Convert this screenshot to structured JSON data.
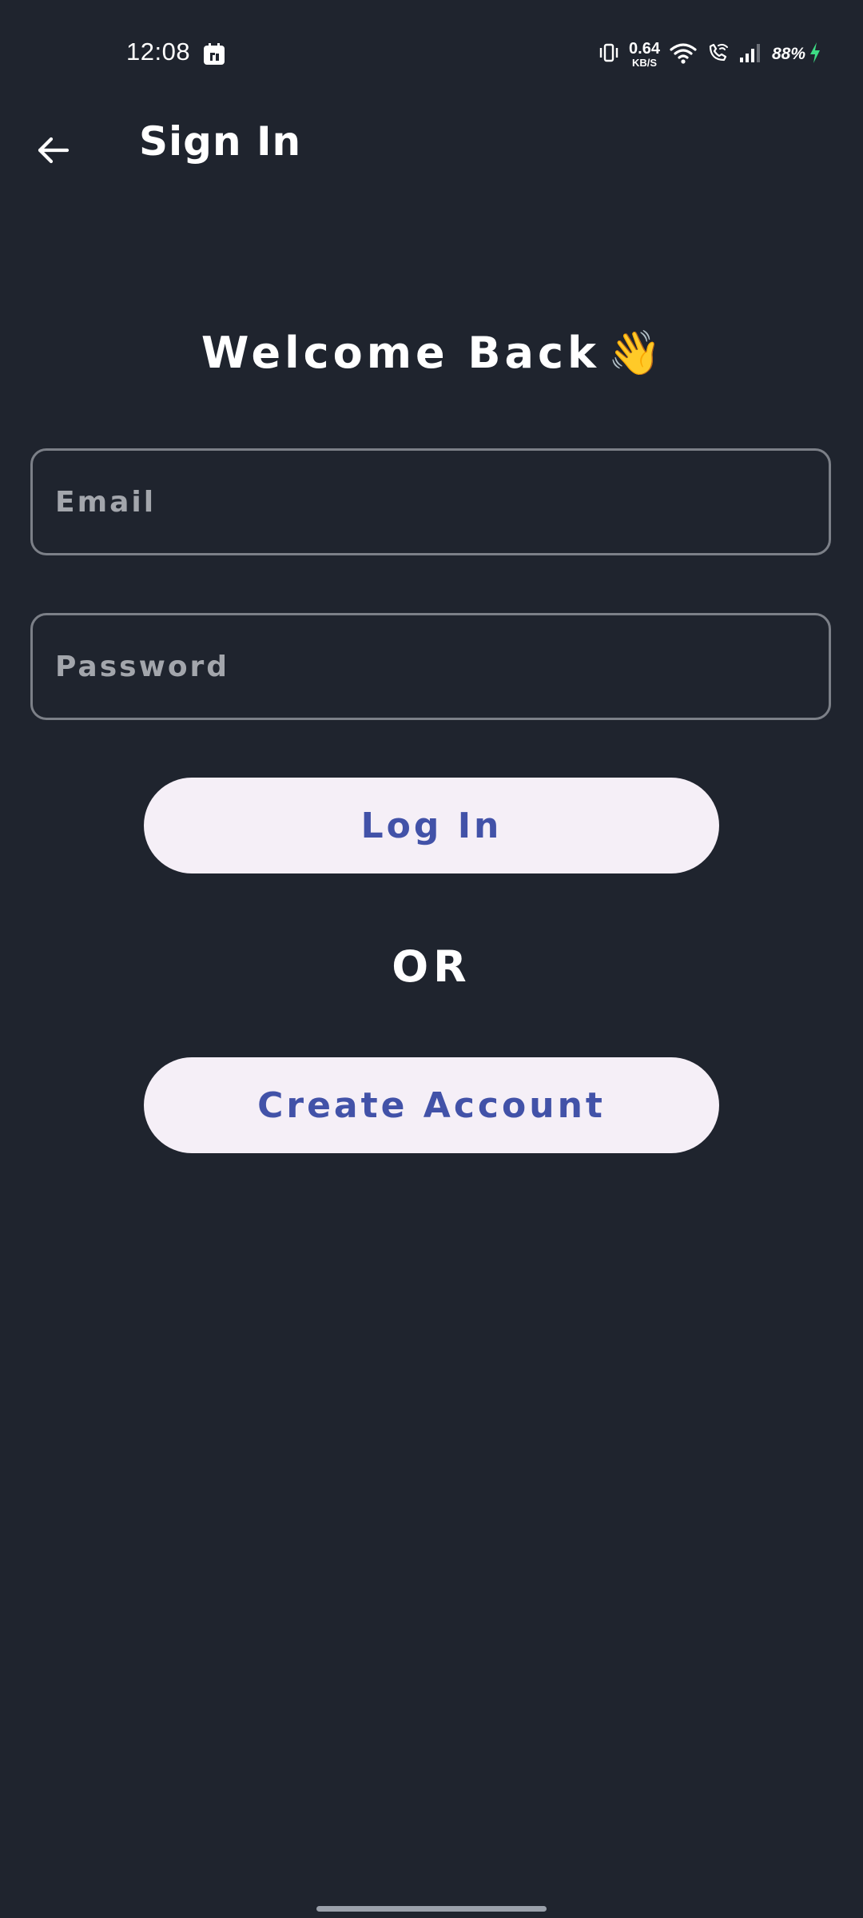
{
  "status_bar": {
    "time": "12:08",
    "net_speed_value": "0.64",
    "net_speed_unit": "KB/S",
    "battery": "88%",
    "icons": [
      "app-notification-icon",
      "vibrate-icon",
      "wifi-icon",
      "wifi-calling-icon",
      "signal-icon",
      "charging-icon"
    ]
  },
  "app_bar": {
    "title": "Sign In",
    "back_icon": "arrow-left-icon"
  },
  "main": {
    "welcome_text": "Welcome Back",
    "welcome_emoji": "👋",
    "email_placeholder": "Email",
    "password_placeholder": "Password",
    "login_label": "Log In",
    "or_text": "OR",
    "create_account_label": "Create Account"
  },
  "colors": {
    "background": "#1f242e",
    "button_background": "#f5eff7",
    "button_text": "#4252a8",
    "field_border": "#7c8088",
    "charging": "#3ddc84"
  }
}
